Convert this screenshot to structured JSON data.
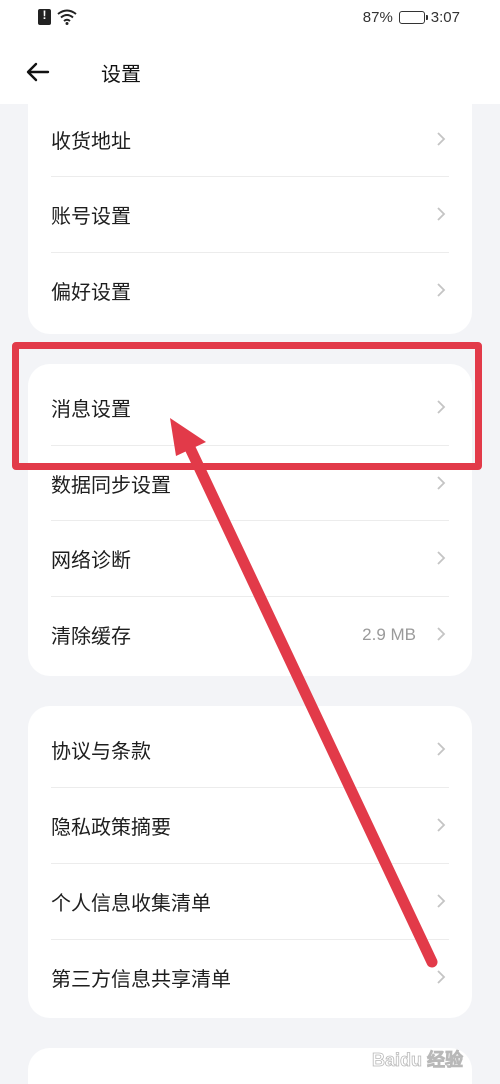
{
  "status_bar": {
    "battery_percent_text": "87%",
    "battery_level": 0.87,
    "time": "3:07"
  },
  "header": {
    "back_icon": "arrow-left-icon",
    "title": "设置"
  },
  "group1": [
    {
      "label": "收货地址"
    },
    {
      "label": "账号设置"
    },
    {
      "label": "偏好设置"
    }
  ],
  "group2": [
    {
      "label": "消息设置"
    },
    {
      "label": "数据同步设置"
    },
    {
      "label": "网络诊断"
    },
    {
      "label": "清除缓存",
      "value": "2.9 MB"
    }
  ],
  "group3": [
    {
      "label": "协议与条款"
    },
    {
      "label": "隐私政策摘要"
    },
    {
      "label": "个人信息收集清单"
    },
    {
      "label": "第三方信息共享清单"
    }
  ],
  "colors": {
    "highlight": "#e23a49",
    "background": "#f3f4f7",
    "card": "#ffffff"
  },
  "watermark_text": "Baidu 经验"
}
